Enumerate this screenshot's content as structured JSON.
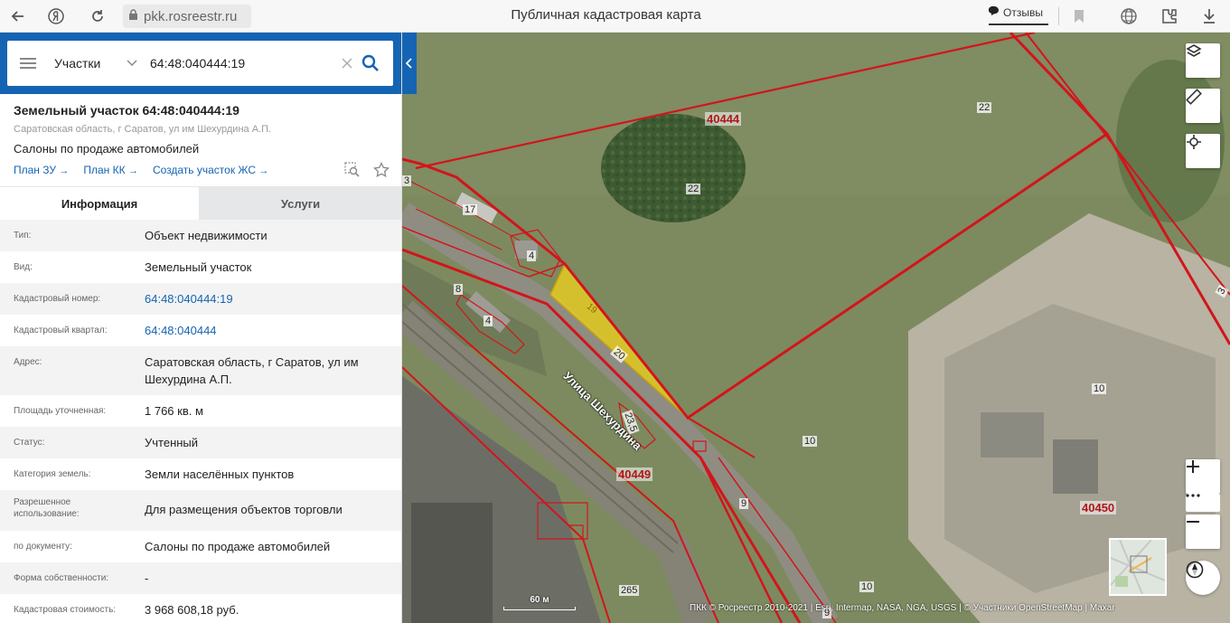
{
  "browser": {
    "url": "pkk.rosreestr.ru",
    "page_title": "Публичная кадастровая карта",
    "reviews_label": "Отзывы",
    "icons": [
      "back-icon",
      "yandex-icon",
      "refresh-icon",
      "lock-icon",
      "bookmark-icon",
      "globe-icon",
      "extensions-icon",
      "download-icon"
    ]
  },
  "search": {
    "type_label": "Участки",
    "value": "64:48:040444:19"
  },
  "object": {
    "title": "Земельный участок 64:48:040444:19",
    "address": "Саратовская область, г Саратов, ул им Шехурдина А.П.",
    "description": "Салоны по продаже автомобилей",
    "links": [
      {
        "label": "План ЗУ"
      },
      {
        "label": "План КК"
      },
      {
        "label": "Создать участок ЖС"
      }
    ]
  },
  "tabs": {
    "info": "Информация",
    "services": "Услуги"
  },
  "info_rows": [
    {
      "label": "Тип:",
      "value": "Объект недвижимости"
    },
    {
      "label": "Вид:",
      "value": "Земельный участок"
    },
    {
      "label": "Кадастровый номер:",
      "value": "64:48:040444:19"
    },
    {
      "label": "Кадастровый квартал:",
      "value": "64:48:040444"
    },
    {
      "label": "Адрес:",
      "value": "Саратовская область, г Саратов, ул им Шехурдина А.П."
    },
    {
      "label": "Площадь уточненная:",
      "value": "1 766 кв. м"
    },
    {
      "label": "Статус:",
      "value": "Учтенный"
    },
    {
      "label": "Категория земель:",
      "value": "Земли населённых пунктов"
    },
    {
      "label": "Разрешенное использование:",
      "value": "Для размещения объектов торговли"
    },
    {
      "label": "по документу:",
      "value": "Салоны по продаже автомобилей"
    },
    {
      "label": "Форма собственности:",
      "value": "-"
    },
    {
      "label": "Кадастровая стоимость:",
      "value": "3 968 608,18 руб."
    }
  ],
  "map": {
    "labels": {
      "block_40444": "40444",
      "block_40449": "40449",
      "block_40450": "40450",
      "n22a": "22",
      "n22b": "22",
      "n17": "17",
      "n4a": "4",
      "n4b": "4",
      "n8": "8",
      "n19": "19",
      "n20": "20",
      "n23_5": "23,5",
      "n10a": "10",
      "n10b": "10",
      "n10c": "10",
      "n9a": "9",
      "n9b": "9",
      "n3a": "3",
      "n3b": "3",
      "n265": "265",
      "street": "Улица Шехурдина"
    },
    "scale_label": "60 м",
    "attribution": "ПКК © Росреестр 2010-2021 | Esri, Intermap, NASA, NGA, USGS | © Участники OpenStreetMap | Maxar",
    "controls": [
      "layers-icon",
      "ruler-icon",
      "locate-icon",
      "zoom-in-icon",
      "more-icon",
      "zoom-out-icon",
      "compass-icon"
    ],
    "colors": {
      "boundary": "#d2151b",
      "selected_fill": "#f1d21c",
      "label": "#b0161b"
    }
  }
}
